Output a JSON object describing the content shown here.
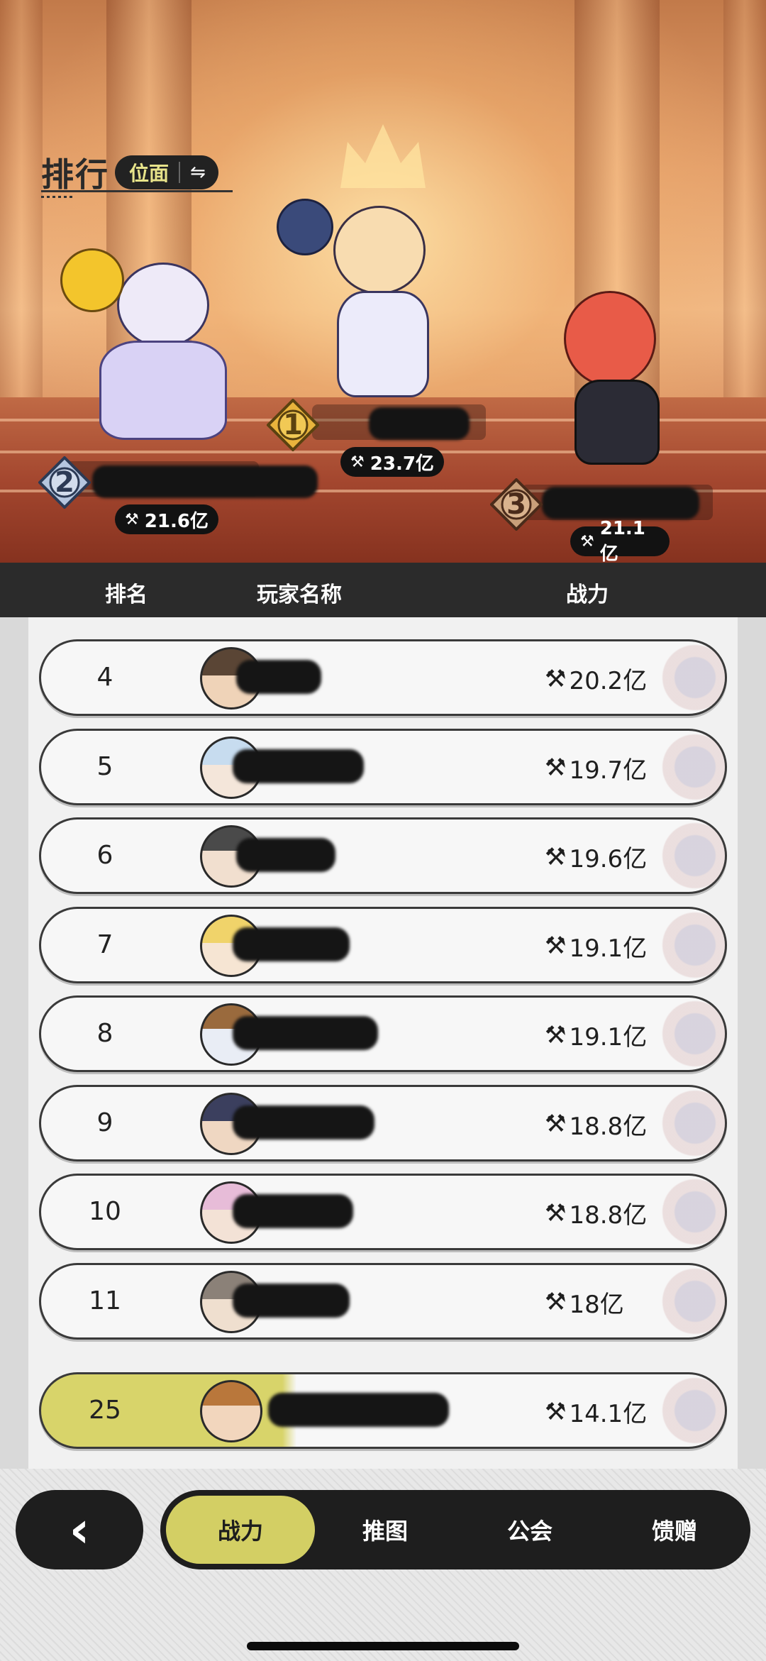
{
  "hero": {
    "title": "排行",
    "server_label": "位面",
    "swap_icon": "⇋",
    "podium": [
      {
        "rank": "1",
        "power": "23.7亿"
      },
      {
        "rank": "2",
        "power": "21.6亿"
      },
      {
        "rank": "3",
        "power": "21.1亿"
      }
    ]
  },
  "table_head": {
    "rank": "排名",
    "player": "玩家名称",
    "power": "战力"
  },
  "rows": [
    {
      "rank": "4",
      "power": "20.2亿"
    },
    {
      "rank": "5",
      "power": "19.7亿"
    },
    {
      "rank": "6",
      "power": "19.6亿"
    },
    {
      "rank": "7",
      "power": "19.1亿"
    },
    {
      "rank": "8",
      "power": "19.1亿"
    },
    {
      "rank": "9",
      "power": "18.8亿"
    },
    {
      "rank": "10",
      "power": "18.8亿"
    },
    {
      "rank": "11",
      "power": "18亿"
    }
  ],
  "my_row": {
    "rank": "25",
    "power": "14.1亿"
  },
  "icons": {
    "power": "⚒",
    "back": "‹"
  },
  "nav": {
    "tabs": [
      "战力",
      "推图",
      "公会",
      "馈赠"
    ],
    "active": "战力"
  },
  "colors": {
    "accent": "#d3cf64",
    "dark": "#1e1e1e"
  }
}
